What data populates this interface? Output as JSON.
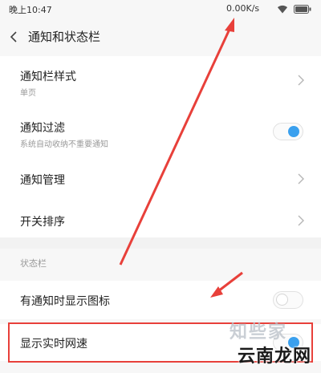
{
  "statusbar": {
    "time": "晚上10:47",
    "net_speed": "0.00K/s",
    "wifi_icon": "wifi-icon",
    "battery_icon": "battery-icon"
  },
  "header": {
    "title": "通知和状态栏",
    "back_icon": "back-arrow-icon"
  },
  "items": [
    {
      "label": "通知栏样式",
      "sub": "单页",
      "control": "chevron"
    },
    {
      "label": "通知过滤",
      "sub": "系统自动收纳不重要通知",
      "control": "toggle",
      "toggle_on": true
    },
    {
      "label": "通知管理",
      "control": "chevron"
    },
    {
      "label": "开关排序",
      "control": "chevron"
    }
  ],
  "section": {
    "label": "状态栏",
    "items": [
      {
        "label": "有通知时显示图标",
        "control": "toggle",
        "toggle_on": false
      },
      {
        "label": "显示实时网速",
        "control": "toggle",
        "toggle_on": true
      }
    ]
  },
  "watermark": {
    "logo_text": "知些家",
    "site": "云南龙网"
  },
  "colors": {
    "accent": "#3aa0ee",
    "annotation": "#e8403a"
  }
}
